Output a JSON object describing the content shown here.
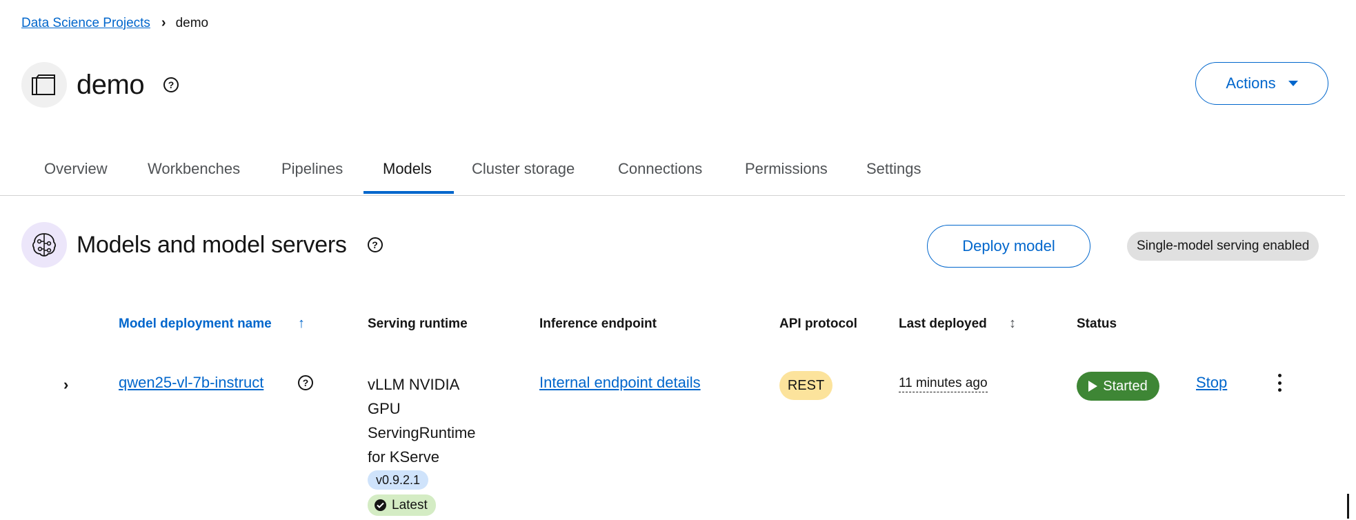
{
  "breadcrumb": {
    "parent": "Data Science Projects",
    "current": "demo"
  },
  "project": {
    "title": "demo",
    "icon": "project-folder-icon"
  },
  "actions": {
    "label": "Actions"
  },
  "tabs": [
    {
      "label": "Overview",
      "active": false
    },
    {
      "label": "Workbenches",
      "active": false
    },
    {
      "label": "Pipelines",
      "active": false
    },
    {
      "label": "Models",
      "active": true
    },
    {
      "label": "Cluster storage",
      "active": false
    },
    {
      "label": "Connections",
      "active": false
    },
    {
      "label": "Permissions",
      "active": false
    },
    {
      "label": "Settings",
      "active": false
    }
  ],
  "section": {
    "title": "Models and model servers",
    "icon": "model-server-icon",
    "deploy_label": "Deploy model",
    "serving_label": "Single-model serving enabled"
  },
  "table": {
    "columns": [
      "Model deployment name",
      "Serving runtime",
      "Inference endpoint",
      "API protocol",
      "Last deployed",
      "Status"
    ],
    "rows": [
      {
        "name": "qwen25-vl-7b-instruct",
        "runtime": "vLLM NVIDIA GPU ServingRuntime for KServe",
        "runtime_version": "v0.9.2.1",
        "runtime_tag": "Latest",
        "endpoint": "Internal endpoint details",
        "protocol": "REST",
        "last_deployed": "11 minutes ago",
        "status": "Started",
        "stop_label": "Stop"
      }
    ]
  },
  "colors": {
    "link": "#0066cc",
    "status_started": "#3e8635",
    "protocol_badge": "#fce39c",
    "version_badge": "#cfe3fb",
    "latest_badge": "#d4ecc4"
  }
}
